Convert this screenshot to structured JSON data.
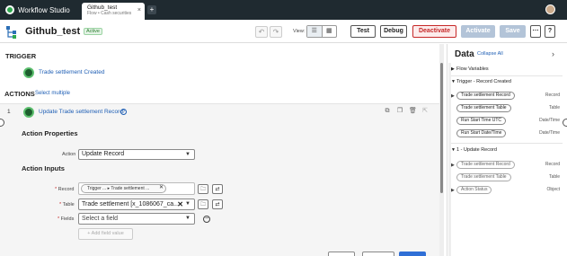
{
  "browser": {
    "app_title": "Workflow Studio",
    "tab": {
      "title": "Github_test",
      "subtitle": "Flow • Cash securities",
      "close": "×"
    },
    "new_tab": "+"
  },
  "header": {
    "flow_title": "Github_test",
    "status": "Active",
    "undo": "↶",
    "redo": "↷",
    "view_label": "View:",
    "buttons": {
      "test": "Test",
      "debug": "Debug",
      "deactivate": "Deactivate",
      "activate": "Activate",
      "save": "Save",
      "more": "⋯",
      "help": "?"
    }
  },
  "canvas": {
    "trigger_heading": "TRIGGER",
    "trigger_name": "Trade settlement Created",
    "actions_heading": "ACTIONS",
    "select_multiple": "Select multiple",
    "action": {
      "number": "1",
      "name": "Update Trade settlement Record",
      "help": "?",
      "properties_heading": "Action Properties",
      "action_label": "Action",
      "action_value": "Update Record",
      "inputs_heading": "Action Inputs",
      "record_label": "Record",
      "record_chip": "Trigger ... ▸ Trade settlement ...",
      "table_label": "Table",
      "table_value": "Trade settlement [x_1086067_ca...",
      "fields_label": "Fields",
      "fields_placeholder": "Select a field",
      "add_field": "+ Add field value",
      "required_mark": "*"
    }
  },
  "data_panel": {
    "title": "Data",
    "collapse_all": "Collapse All",
    "chevron": "›",
    "sections": {
      "flow_variables": "Flow Variables",
      "trigger": "Trigger - Record Created",
      "update": "1 - Update Record"
    },
    "trigger_items": [
      {
        "label": "Trade settlement Record",
        "type": "Record"
      },
      {
        "label": "Trade settlement Table",
        "type": "Table"
      },
      {
        "label": "Run Start Time UTC",
        "type": "Date/Time"
      },
      {
        "label": "Run Start Date/Time",
        "type": "Date/Time"
      }
    ],
    "update_items": [
      {
        "label": "Trade settlement Record",
        "type": "Record"
      },
      {
        "label": "Trade settlement Table",
        "type": "Table"
      },
      {
        "label": "Action Status",
        "type": "Object"
      }
    ]
  },
  "colors": {
    "accent": "#1f5fb5",
    "active_green": "#2e7d32",
    "deactivate_red": "#c62828",
    "topbar": "#1f2a30"
  }
}
